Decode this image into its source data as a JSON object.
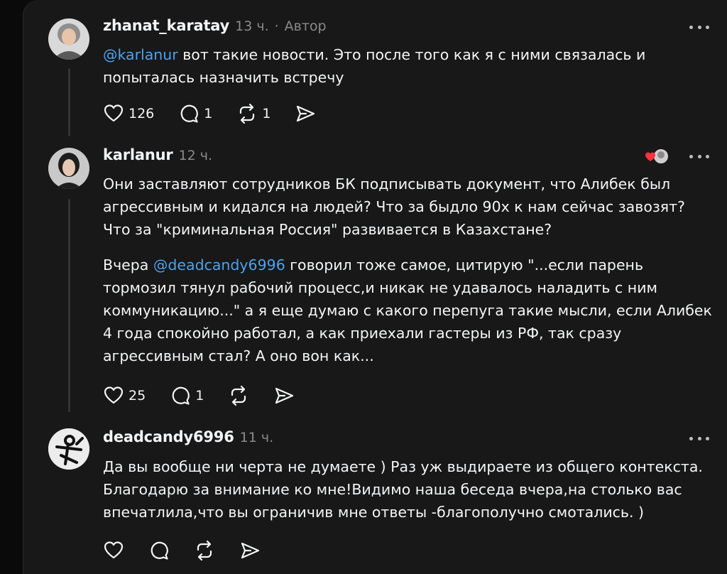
{
  "posts": [
    {
      "username": "zhanat_karatay",
      "time": "13 ч.",
      "separator": "·",
      "author_label": "Автор",
      "mention": "@karlanur",
      "text_after_mention": " вот такие новости. Это после того как я с ними связалась и попыталась назначить встречу",
      "likes": "126",
      "replies": "1",
      "reposts": "1"
    },
    {
      "username": "karlanur",
      "time": "12 ч.",
      "paragraph1": "Они заставляют сотрудников БК подписывать документ, что Алибек был агрессивным и кидался на людей? Что за быдло 90х к нам сейчас завозят? Что за \"криминальная Россия\" развивается в Казахстане?",
      "p2_before": "Вчера ",
      "p2_mention": "@deadcandy6996",
      "p2_after": " говорил тоже самое, цитирую \"...если парень тормозил тянул рабочий процесс,и никак не удавалось наладить с ним коммуникацию...\" а я еще думаю с какого перепуга такие мысли, если Алибек 4 года спокойно работал, а как приехали гастеры из РФ, так сразу агрессивным стал? А оно вон как...",
      "likes": "25",
      "replies": "1"
    },
    {
      "username": "deadcandy6996",
      "time": "11 ч.",
      "text": "Да вы вообще ни черта не думаете ) Раз уж выдираете из общего контекста. Благодарю за внимание ко мне!Видимо наша беседа вчера,на столько вас впечатлила,что вы ограничив мне ответы -благополучно смотались. )"
    }
  ],
  "icons": {
    "like": "heart-icon",
    "reply": "comment-icon",
    "repost": "repost-icon",
    "share": "send-icon",
    "more": "more-icon"
  },
  "colors": {
    "mention": "#4aa3f0",
    "liked_heart": "#ff3040",
    "panel": "#181818"
  }
}
